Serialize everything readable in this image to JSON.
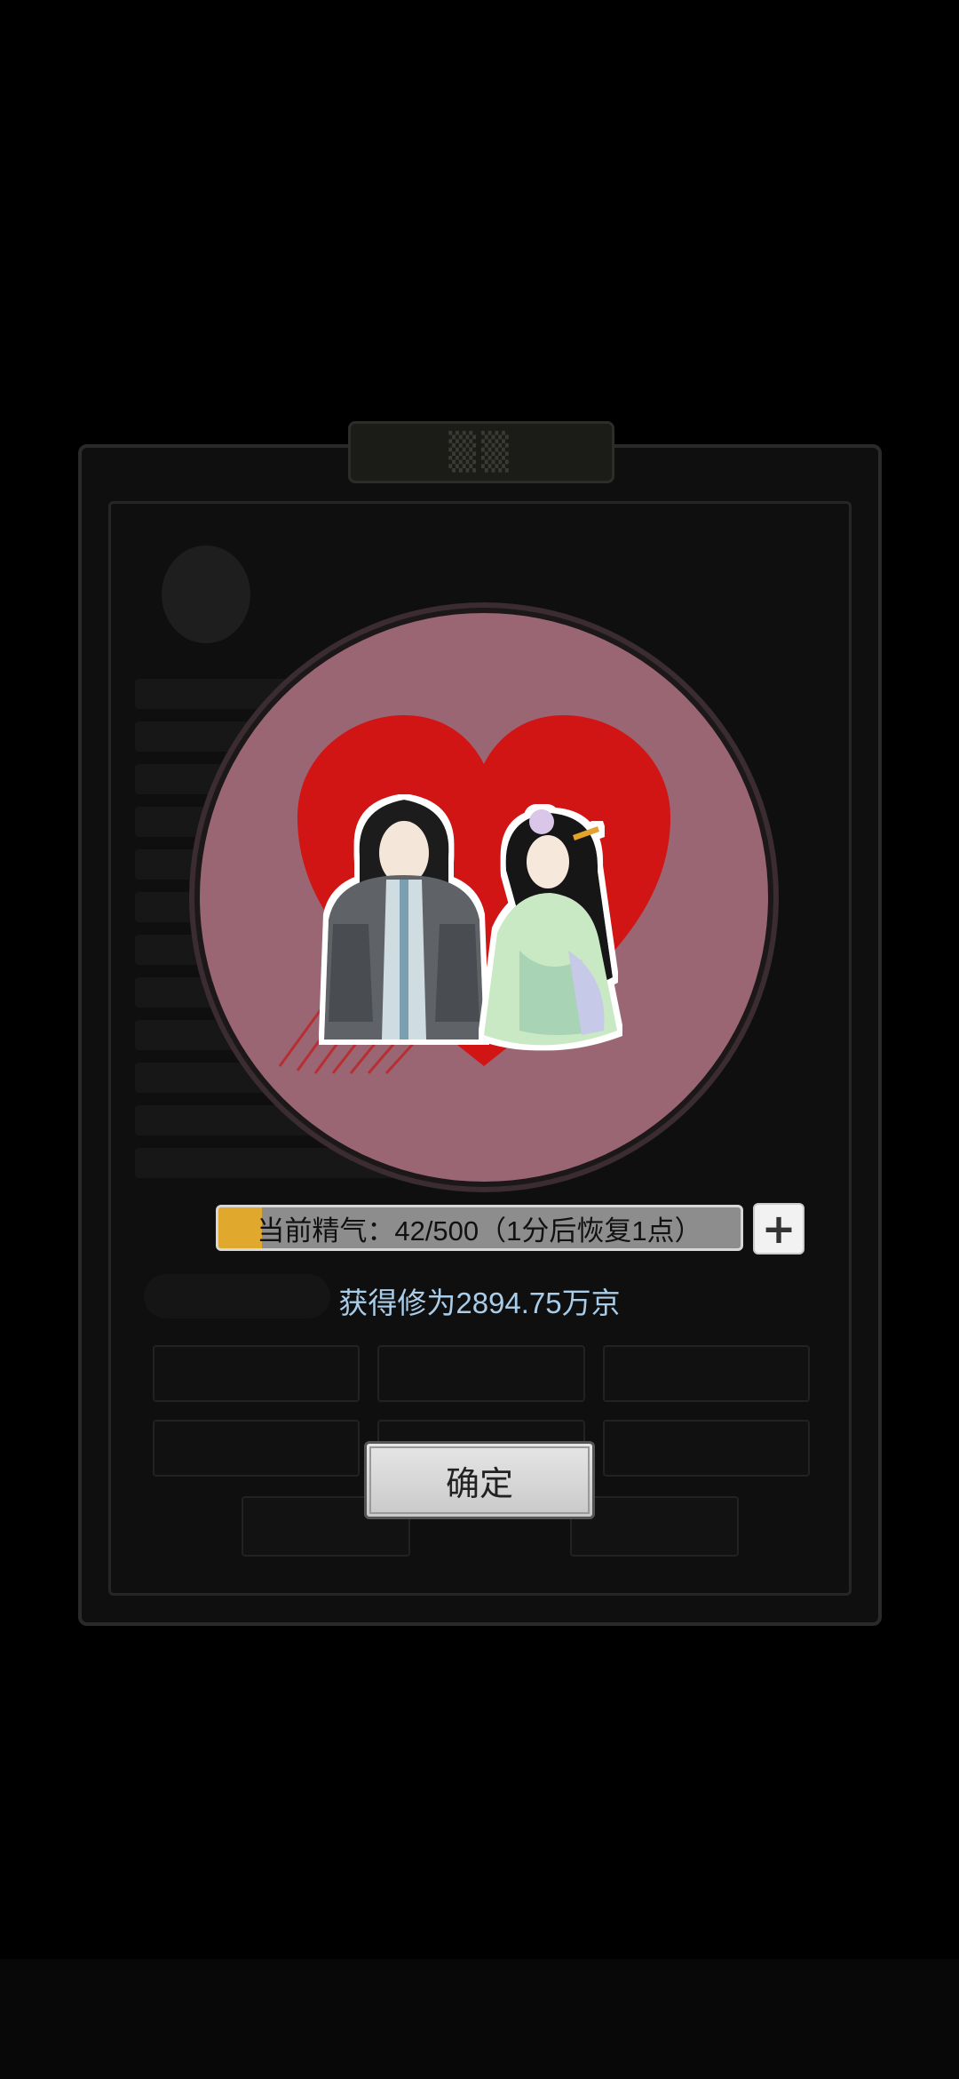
{
  "energy": {
    "label": "当前精气：42/500（1分后恢复1点）",
    "current": 42,
    "max": 500,
    "fill_fraction": 0.084,
    "plus_label": "+"
  },
  "reward": {
    "text": "获得修为2894.75万京"
  },
  "confirm": {
    "label": "确定"
  },
  "colors": {
    "circle": "#9b6673",
    "heart": "#d11414",
    "energy_fill": "#e0a92d",
    "energy_track": "#8d8d8d",
    "reward_text": "#a9cde8"
  },
  "icons": {
    "plus": "plus-icon",
    "heart": "heart-icon"
  }
}
